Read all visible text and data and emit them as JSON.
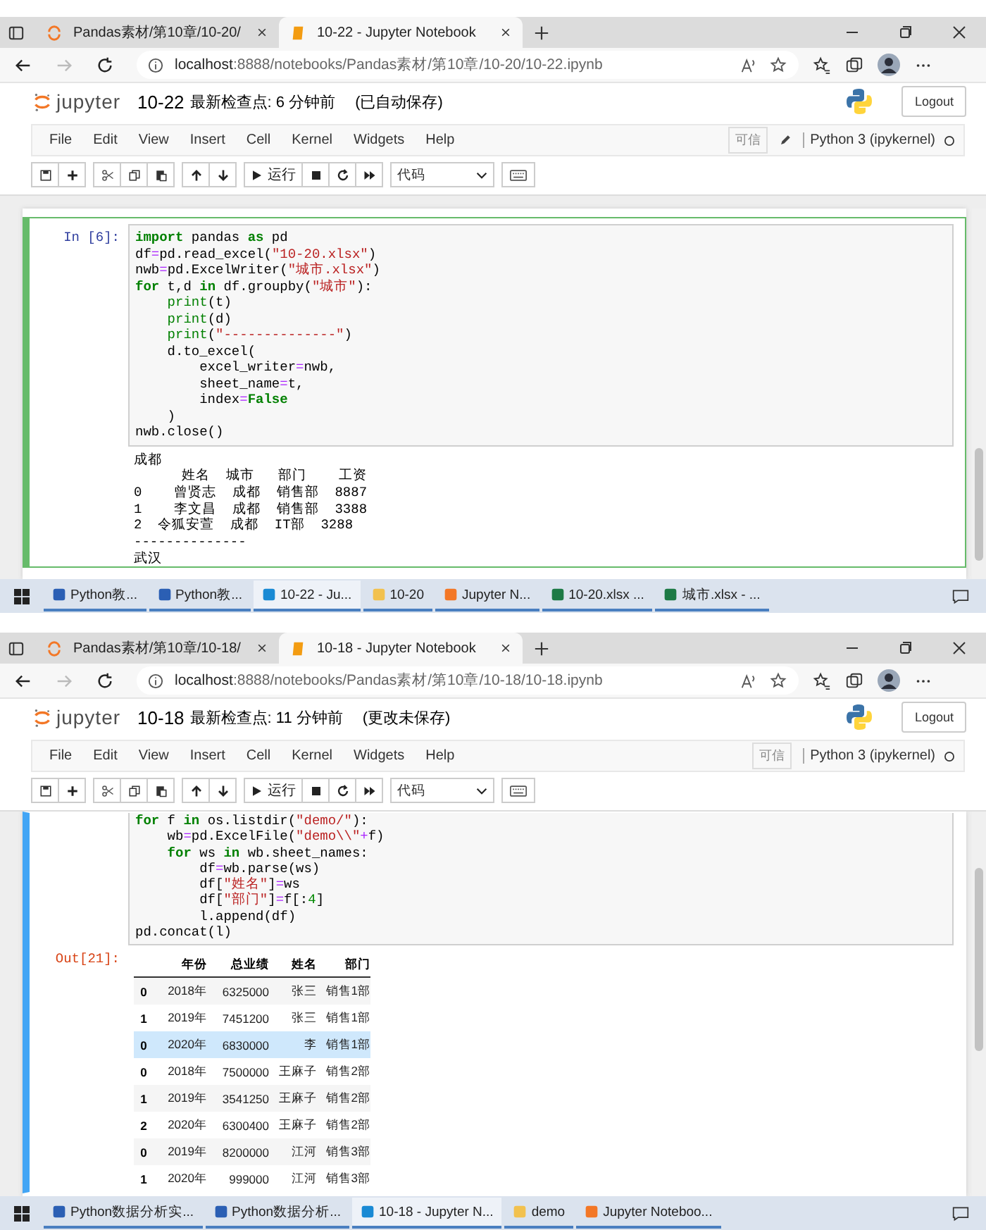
{
  "panels": [
    {
      "browser_tabs": [
        {
          "label": "Pandas素材/第10章/10-20/",
          "selected": false
        },
        {
          "label": "10-22 - Jupyter Notebook",
          "selected": true
        }
      ],
      "url": {
        "host": "localhost",
        "path": ":8888/notebooks/Pandas素材/第10章/10-20/10-22.ipynb"
      },
      "header": {
        "logo_text": "jupyter",
        "notebook_name": "10-22",
        "checkpoint": "最新检查点: 6 分钟前",
        "save_status": "(已自动保存)",
        "logout": "Logout"
      },
      "menu": [
        "File",
        "Edit",
        "View",
        "Insert",
        "Cell",
        "Kernel",
        "Widgets",
        "Help"
      ],
      "trusted": "可信",
      "show_edit_icon": true,
      "kernel": "Python 3 (ipykernel)",
      "toolbar": {
        "run": "运行",
        "cell_type": "代码"
      },
      "cell": {
        "kind": "edit",
        "prompt": "In [6]:",
        "code": [
          [
            {
              "t": "import",
              "kind": "kw"
            },
            {
              "t": " pandas ",
              "kind": "plain"
            },
            {
              "t": "as",
              "kind": "kw"
            },
            {
              "t": " pd",
              "kind": "plain"
            }
          ],
          [
            {
              "t": "df",
              "kind": "plain"
            },
            {
              "t": "=",
              "kind": "op"
            },
            {
              "t": "pd.read_excel(",
              "kind": "plain"
            },
            {
              "t": "\"10-20.xlsx\"",
              "kind": "str"
            },
            {
              "t": ")",
              "kind": "plain"
            }
          ],
          [
            {
              "t": "nwb",
              "kind": "plain"
            },
            {
              "t": "=",
              "kind": "op"
            },
            {
              "t": "pd.ExcelWriter(",
              "kind": "plain"
            },
            {
              "t": "\"城市.xlsx\"",
              "kind": "str"
            },
            {
              "t": ")",
              "kind": "plain"
            }
          ],
          [
            {
              "t": "for",
              "kind": "kw"
            },
            {
              "t": " t,d ",
              "kind": "plain"
            },
            {
              "t": "in",
              "kind": "kw"
            },
            {
              "t": " df.groupby(",
              "kind": "plain"
            },
            {
              "t": "\"城市\"",
              "kind": "str"
            },
            {
              "t": "):",
              "kind": "plain"
            }
          ],
          [
            {
              "t": "    print",
              "kind": "builtin"
            },
            {
              "t": "(t)",
              "kind": "plain"
            }
          ],
          [
            {
              "t": "    print",
              "kind": "builtin"
            },
            {
              "t": "(d)",
              "kind": "plain"
            }
          ],
          [
            {
              "t": "    print",
              "kind": "builtin"
            },
            {
              "t": "(",
              "kind": "plain"
            },
            {
              "t": "\"--------------\"",
              "kind": "str"
            },
            {
              "t": ")",
              "kind": "plain"
            }
          ],
          [
            {
              "t": "    d.to_excel(",
              "kind": "plain"
            }
          ],
          [
            {
              "t": "        excel_writer",
              "kind": "plain"
            },
            {
              "t": "=",
              "kind": "op"
            },
            {
              "t": "nwb,",
              "kind": "plain"
            }
          ],
          [
            {
              "t": "        sheet_name",
              "kind": "plain"
            },
            {
              "t": "=",
              "kind": "op"
            },
            {
              "t": "t,",
              "kind": "plain"
            }
          ],
          [
            {
              "t": "        index",
              "kind": "plain"
            },
            {
              "t": "=",
              "kind": "op"
            },
            {
              "t": "False",
              "kind": "kw"
            }
          ],
          [
            {
              "t": "    )",
              "kind": "plain"
            }
          ],
          [
            {
              "t": "nwb.close()",
              "kind": "plain"
            }
          ]
        ],
        "output_text": [
          "成都",
          "      姓名  城市   部门    工资",
          "0    曾贤志  成都  销售部  8887",
          "1    李文昌  成都  销售部  3388",
          "2  令狐安萱  成都  IT部  3288",
          "--------------",
          "武汉"
        ]
      },
      "taskbar": [
        {
          "label": "Python教...",
          "kind": "word",
          "selected": false
        },
        {
          "label": "Python教...",
          "kind": "word",
          "selected": false
        },
        {
          "label": "10-22 - Ju...",
          "kind": "edge",
          "selected": true
        },
        {
          "label": "10-20",
          "kind": "folder",
          "selected": false
        },
        {
          "label": "Jupyter N...",
          "kind": "jupyter",
          "selected": false
        },
        {
          "label": "10-20.xlsx ...",
          "kind": "excel",
          "selected": false
        },
        {
          "label": "城市.xlsx - ...",
          "kind": "excel",
          "selected": false
        }
      ]
    },
    {
      "browser_tabs": [
        {
          "label": "Pandas素材/第10章/10-18/",
          "selected": false
        },
        {
          "label": "10-18 - Jupyter Notebook",
          "selected": true
        }
      ],
      "url": {
        "host": "localhost",
        "path": ":8888/notebooks/Pandas素材/第10章/10-18/10-18.ipynb"
      },
      "header": {
        "logo_text": "jupyter",
        "notebook_name": "10-18",
        "checkpoint": "最新检查点: 11 分钟前",
        "save_status": "(更改未保存)",
        "logout": "Logout"
      },
      "menu": [
        "File",
        "Edit",
        "View",
        "Insert",
        "Cell",
        "Kernel",
        "Widgets",
        "Help"
      ],
      "trusted": "可信",
      "show_edit_icon": false,
      "kernel": "Python 3 (ipykernel)",
      "toolbar": {
        "run": "运行",
        "cell_type": "代码"
      },
      "cell": {
        "kind": "command",
        "code": [
          [
            {
              "t": "for",
              "kind": "kw"
            },
            {
              "t": " f ",
              "kind": "plain"
            },
            {
              "t": "in",
              "kind": "kw"
            },
            {
              "t": " os.listdir(",
              "kind": "plain"
            },
            {
              "t": "\"demo/\"",
              "kind": "str"
            },
            {
              "t": "):",
              "kind": "plain"
            }
          ],
          [
            {
              "t": "    wb",
              "kind": "plain"
            },
            {
              "t": "=",
              "kind": "op"
            },
            {
              "t": "pd.ExcelFile(",
              "kind": "plain"
            },
            {
              "t": "\"demo\\\\\"",
              "kind": "str"
            },
            {
              "t": "+",
              "kind": "op"
            },
            {
              "t": "f)",
              "kind": "plain"
            }
          ],
          [
            {
              "t": "    for",
              "kind": "kw"
            },
            {
              "t": " ws ",
              "kind": "plain"
            },
            {
              "t": "in",
              "kind": "kw"
            },
            {
              "t": " wb.sheet_names:",
              "kind": "plain"
            }
          ],
          [
            {
              "t": "        df",
              "kind": "plain"
            },
            {
              "t": "=",
              "kind": "op"
            },
            {
              "t": "wb.parse(ws)",
              "kind": "plain"
            }
          ],
          [
            {
              "t": "        df[",
              "kind": "plain"
            },
            {
              "t": "\"姓名\"",
              "kind": "str"
            },
            {
              "t": "]",
              "kind": "plain"
            },
            {
              "t": "=",
              "kind": "op"
            },
            {
              "t": "ws",
              "kind": "plain"
            }
          ],
          [
            {
              "t": "        df[",
              "kind": "plain"
            },
            {
              "t": "\"部门\"",
              "kind": "str"
            },
            {
              "t": "]",
              "kind": "plain"
            },
            {
              "t": "=",
              "kind": "op"
            },
            {
              "t": "f[:",
              "kind": "plain"
            },
            {
              "t": "4",
              "kind": "num"
            },
            {
              "t": "]",
              "kind": "plain"
            }
          ],
          [
            {
              "t": "        l.append(df)",
              "kind": "plain"
            }
          ],
          [
            {
              "t": "pd.concat(l)",
              "kind": "plain"
            }
          ]
        ],
        "output_prompt": "Out[21]:",
        "table": {
          "columns": [
            "年份",
            "总业绩",
            "姓名",
            "部门"
          ],
          "rows": [
            {
              "index": "0",
              "cells": [
                "2018年",
                "6325000",
                "张三",
                "销售1部"
              ],
              "selected": false
            },
            {
              "index": "1",
              "cells": [
                "2019年",
                "7451200",
                "张三",
                "销售1部"
              ],
              "selected": false
            },
            {
              "index": "0",
              "cells": [
                "2020年",
                "6830000",
                "李",
                "销售1部"
              ],
              "selected": true
            },
            {
              "index": "0",
              "cells": [
                "2018年",
                "7500000",
                "王麻子",
                "销售2部"
              ],
              "selected": false
            },
            {
              "index": "1",
              "cells": [
                "2019年",
                "3541250",
                "王麻子",
                "销售2部"
              ],
              "selected": false
            },
            {
              "index": "2",
              "cells": [
                "2020年",
                "6300400",
                "王麻子",
                "销售2部"
              ],
              "selected": false
            },
            {
              "index": "0",
              "cells": [
                "2019年",
                "8200000",
                "江河",
                "销售3部"
              ],
              "selected": false
            },
            {
              "index": "1",
              "cells": [
                "2020年",
                "999000",
                "江河",
                "销售3部"
              ],
              "selected": false
            }
          ]
        }
      },
      "taskbar": [
        {
          "label": "Python数据分析实...",
          "kind": "word",
          "selected": false
        },
        {
          "label": "Python数据分析...",
          "kind": "word",
          "selected": false
        },
        {
          "label": "10-18 - Jupyter N...",
          "kind": "edge",
          "selected": true
        },
        {
          "label": "demo",
          "kind": "folder",
          "selected": false
        },
        {
          "label": "Jupyter Noteboo...",
          "kind": "jupyter",
          "selected": false
        }
      ]
    }
  ]
}
